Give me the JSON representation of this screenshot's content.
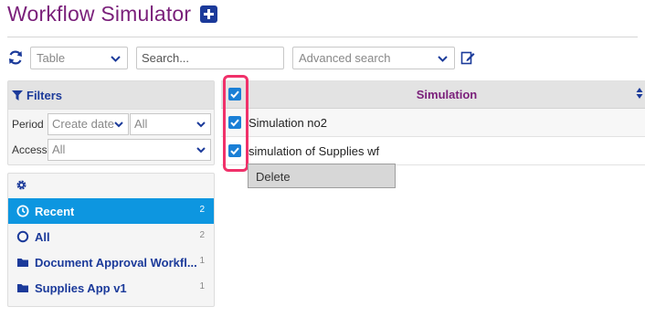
{
  "header": {
    "title": "Workflow Simulator"
  },
  "toolbar": {
    "view_select": "Table",
    "search_placeholder": "Search...",
    "advanced_search": "Advanced search"
  },
  "filters": {
    "title": "Filters",
    "period_label": "Period",
    "period_field": "Create date",
    "period_value": "All",
    "access_label": "Access",
    "access_value": "All"
  },
  "nav": {
    "items": [
      {
        "label": "Recent",
        "count": "2",
        "icon": "clock-icon",
        "active": true
      },
      {
        "label": "All",
        "count": "2",
        "icon": "circle-icon",
        "active": false
      },
      {
        "label": "Document Approval Workfl...",
        "count": "1",
        "icon": "folder-icon",
        "active": false
      },
      {
        "label": "Supplies App v1",
        "count": "1",
        "icon": "folder-icon",
        "active": false
      }
    ]
  },
  "table": {
    "column": "Simulation",
    "rows": [
      {
        "name": "Simulation no2",
        "checked": true
      },
      {
        "name": "simulation of Supplies wf",
        "checked": true
      }
    ]
  },
  "context_menu": {
    "delete_label": "Delete"
  },
  "colors": {
    "title": "#7a1f7a",
    "brand": "#1b3a9a",
    "active": "#0d96e0",
    "highlight": "#f0316a"
  }
}
